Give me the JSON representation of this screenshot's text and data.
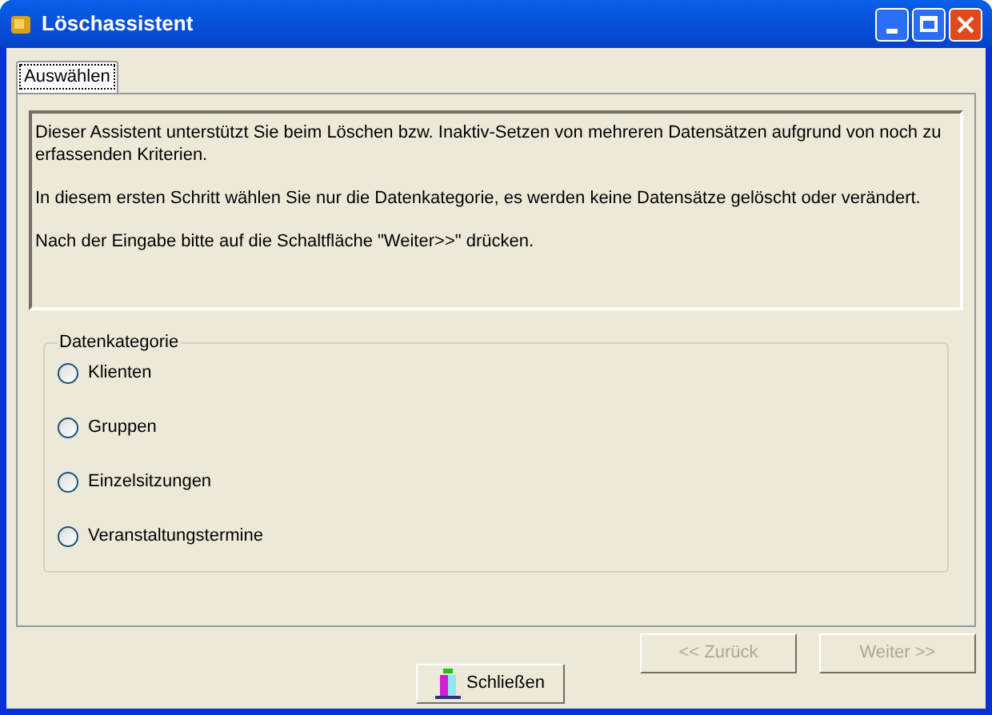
{
  "window": {
    "title": "Löschassistent"
  },
  "tabs": [
    {
      "label": "Auswählen",
      "selected": true
    }
  ],
  "info_text": [
    "Dieser Assistent unterstützt Sie beim Löschen bzw. Inaktiv-Setzen von mehreren Datensätzen aufgrund von noch zu erfassenden Kriterien.",
    "In diesem ersten Schritt wählen Sie nur die Datenkategorie, es werden keine Datensätze gelöscht oder verändert.",
    "Nach der Eingabe bitte auf die Schaltfläche \"Weiter>>\" drücken."
  ],
  "group": {
    "title": "Datenkategorie",
    "options": [
      {
        "label": "Klienten",
        "selected": false
      },
      {
        "label": "Gruppen",
        "selected": false
      },
      {
        "label": "Einzelsitzungen",
        "selected": false
      },
      {
        "label": "Veranstaltungstermine",
        "selected": false
      }
    ]
  },
  "nav_buttons": [
    {
      "label": "<< Zurück",
      "disabled": true
    },
    {
      "label": "Weiter >>",
      "disabled": true
    }
  ],
  "close_button": {
    "label": "Schließen"
  }
}
